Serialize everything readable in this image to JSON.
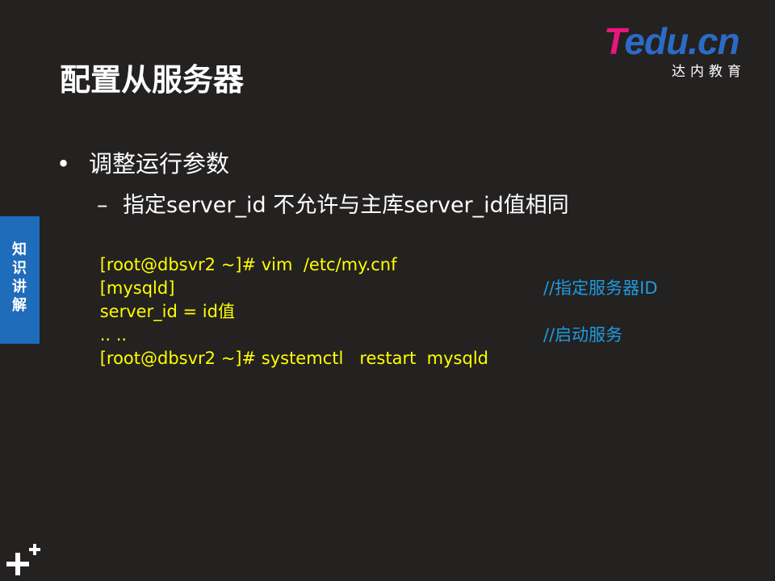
{
  "logo": {
    "text_part1": "T",
    "text_part2": "edu.cn",
    "tagline": "达内教育",
    "colors": {
      "part1": "#e8167e",
      "part2": "#2b6bc5"
    }
  },
  "slide": {
    "title": "配置从服务器",
    "bullet": "调整运行参数",
    "sub_bullet": "指定server_id   不允许与主库server_id值相同"
  },
  "side_tab": {
    "label": "知识讲解"
  },
  "code": {
    "lines": [
      {
        "cmd": "[root@dbsvr2 ~]# vim  /etc/my.cnf",
        "comment": ""
      },
      {
        "cmd": "[mysqld]",
        "comment": ""
      },
      {
        "cmd": "server_id = id值",
        "comment": "//指定服务器ID"
      },
      {
        "cmd": ".. ..",
        "comment": ""
      },
      {
        "cmd": "[root@dbsvr2 ~]# systemctl   restart  mysqld",
        "comment": "//启动服务"
      }
    ]
  },
  "icons": {
    "bottom_left": "plus-icon"
  },
  "colors": {
    "background": "#242121",
    "code_text": "#ffff00",
    "code_comment": "#1e9be0",
    "side_tab": "#1f6cbb"
  }
}
